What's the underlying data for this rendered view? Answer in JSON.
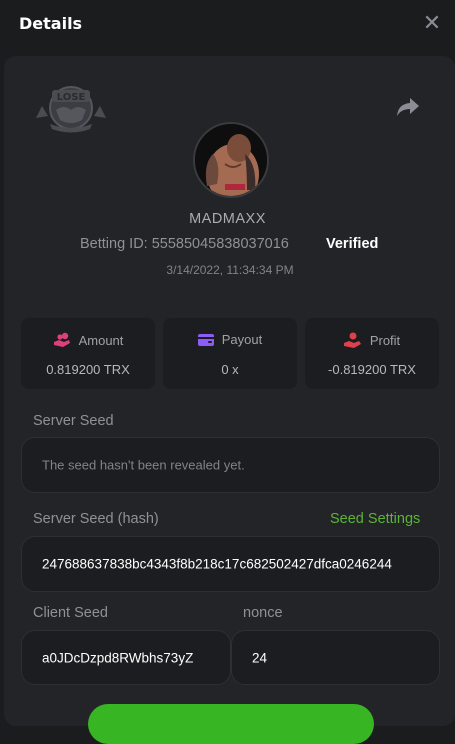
{
  "header": {
    "title": "Details"
  },
  "icons": {
    "close": "close-icon",
    "share": "share-icon",
    "badge": "lose-badge-icon",
    "amount": "coins-hand-icon",
    "payout": "wallet-card-icon",
    "profit": "profit-hand-icon"
  },
  "badge": {
    "text": "LOSE"
  },
  "player": {
    "username": "MADMAXX",
    "betting_label": "Betting ID:",
    "betting_id": "55585045838037016",
    "verified": "Verified",
    "datetime": "3/14/2022, 11:34:34 PM"
  },
  "stats": {
    "amount": {
      "label": "Amount",
      "value": "0.819200 TRX"
    },
    "payout": {
      "label": "Payout",
      "value": "0 x"
    },
    "profit": {
      "label": "Profit",
      "value": "-0.819200 TRX"
    }
  },
  "server_seed": {
    "label": "Server Seed",
    "value": "The seed hasn't been revealed yet."
  },
  "server_seed_hash": {
    "label": "Server Seed (hash)",
    "settings_link": "Seed Settings",
    "value": "247688637838bc4343f8b218c17c682502427dfca0246244"
  },
  "client_seed": {
    "label": "Client Seed",
    "value": "a0JDcDzpd8RWbhs73yZ"
  },
  "nonce": {
    "label": "nonce",
    "value": "24"
  },
  "colors": {
    "accent_green": "#5ab534",
    "amount_icon": "#e0407a",
    "payout_icon": "#8b5cf6",
    "profit_icon": "#e0404a"
  }
}
